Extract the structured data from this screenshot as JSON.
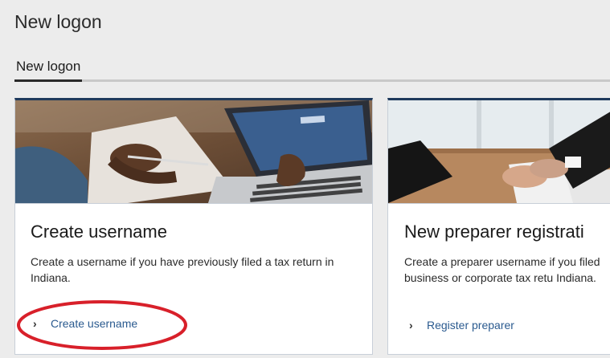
{
  "page": {
    "title": "New logon"
  },
  "tabs": [
    {
      "label": "New logon",
      "active": true
    }
  ],
  "cards": [
    {
      "title": "Create username",
      "description": "Create a username if you have previously filed a tax return in Indiana.",
      "link_label": "Create username",
      "link_icon": "chevron-right-icon",
      "image_alt": "person using laptop"
    },
    {
      "title": "New preparer registrati",
      "description": "Create a preparer username if you filed business or corporate tax retu Indiana.",
      "link_label": "Register preparer",
      "link_icon": "chevron-right-icon",
      "image_alt": "handshake"
    }
  ],
  "colors": {
    "card_top_border": "#1f3a5c",
    "link": "#2a5a8f",
    "annotation": "#d8202a",
    "background": "#ececec"
  }
}
